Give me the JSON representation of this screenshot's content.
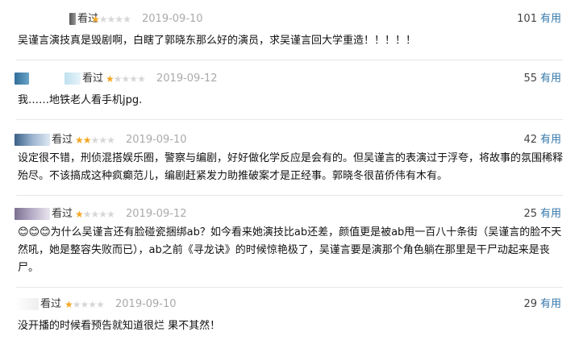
{
  "comments": [
    {
      "status": "看过",
      "stars": 1,
      "date": "2019-09-10",
      "useful_count": "101",
      "useful_label": "有用",
      "text": "吴谨言演技真是毁剧啊，白瞎了郭晓东那么好的演员，求吴谨言回大学重造！！！！！"
    },
    {
      "status": "看过",
      "stars": 1,
      "date": "2019-09-12",
      "useful_count": "55",
      "useful_label": "有用",
      "text": "我……地铁老人看手机jpg."
    },
    {
      "status": "看过",
      "stars": 2,
      "date": "2019-09-10",
      "useful_count": "42",
      "useful_label": "有用",
      "text": "设定很不错，刑侦混搭娱乐圈，警察与编剧，好好做化学反应是会有的。但吴谨言的表演过于浮夸，将故事的氛围稀释殆尽。不该搞成这种疯癫范儿，编剧赶紧发力助推破案才是正经事。郭晓冬很苗侨伟有木有。"
    },
    {
      "status": "看过",
      "stars": 1,
      "date": "2019-09-12",
      "useful_count": "25",
      "useful_label": "有用",
      "text": "😊😊😊为什么吴谨言还有脸碰瓷捆绑ab？如今看来她演技比ab还差，颜值更是被ab甩一百八十条街（吴谨言的脸不天然吼，她是整容失败而已），ab之前《寻龙诀》的时候惊艳极了，吴谨言要是演那个角色躺在那里是干尸动起来是丧尸。"
    },
    {
      "status": "看过",
      "stars": 1,
      "date": "2019-09-10",
      "useful_count": "29",
      "useful_label": "有用",
      "text": "没开播的时候看预告就知道很烂 果不其然！"
    }
  ],
  "colors": {
    "star_on": "#f5a623",
    "star_off": "#d7d7d7",
    "link": "#3377aa",
    "date": "#aaaaaa"
  }
}
